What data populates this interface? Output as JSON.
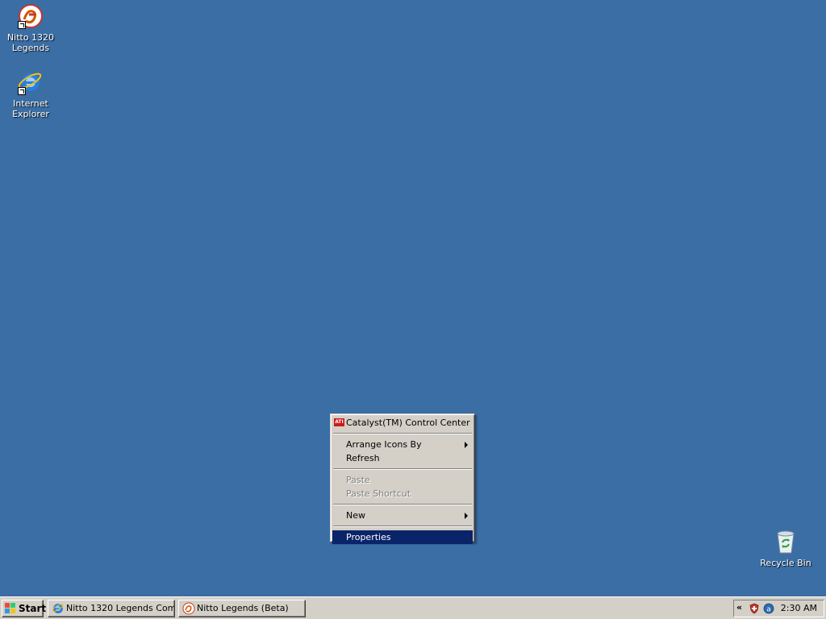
{
  "desktop": {
    "icons": [
      {
        "label_line1": "Nitto 1320",
        "label_line2": "Legends",
        "icon": "nitto-icon"
      },
      {
        "label_line1": "Internet",
        "label_line2": "Explorer",
        "icon": "internet-explorer-icon"
      },
      {
        "label": "Recycle Bin",
        "icon": "recycle-bin-icon"
      }
    ]
  },
  "context_menu": {
    "items": [
      {
        "label": "Catalyst(TM) Control Center",
        "icon": "ati-icon",
        "icon_text": "ATI"
      },
      {
        "label": "Arrange Icons By",
        "submenu": true
      },
      {
        "label": "Refresh"
      },
      {
        "label": "Paste",
        "disabled": true
      },
      {
        "label": "Paste Shortcut",
        "disabled": true
      },
      {
        "label": "New",
        "submenu": true
      },
      {
        "label": "Properties",
        "selected": true
      }
    ]
  },
  "taskbar": {
    "start_label": "Start",
    "tasks": [
      {
        "label": "Nitto 1320 Legends Com...",
        "icon": "internet-explorer-icon"
      },
      {
        "label": "Nitto Legends (Beta)",
        "icon": "nitto-icon"
      }
    ],
    "tray": {
      "chevron": "«",
      "clock": "2:30 AM"
    }
  },
  "colors": {
    "desktop_bg": "#3a6ea5",
    "menu_bg": "#d4d0c8",
    "selection": "#0a246a"
  }
}
